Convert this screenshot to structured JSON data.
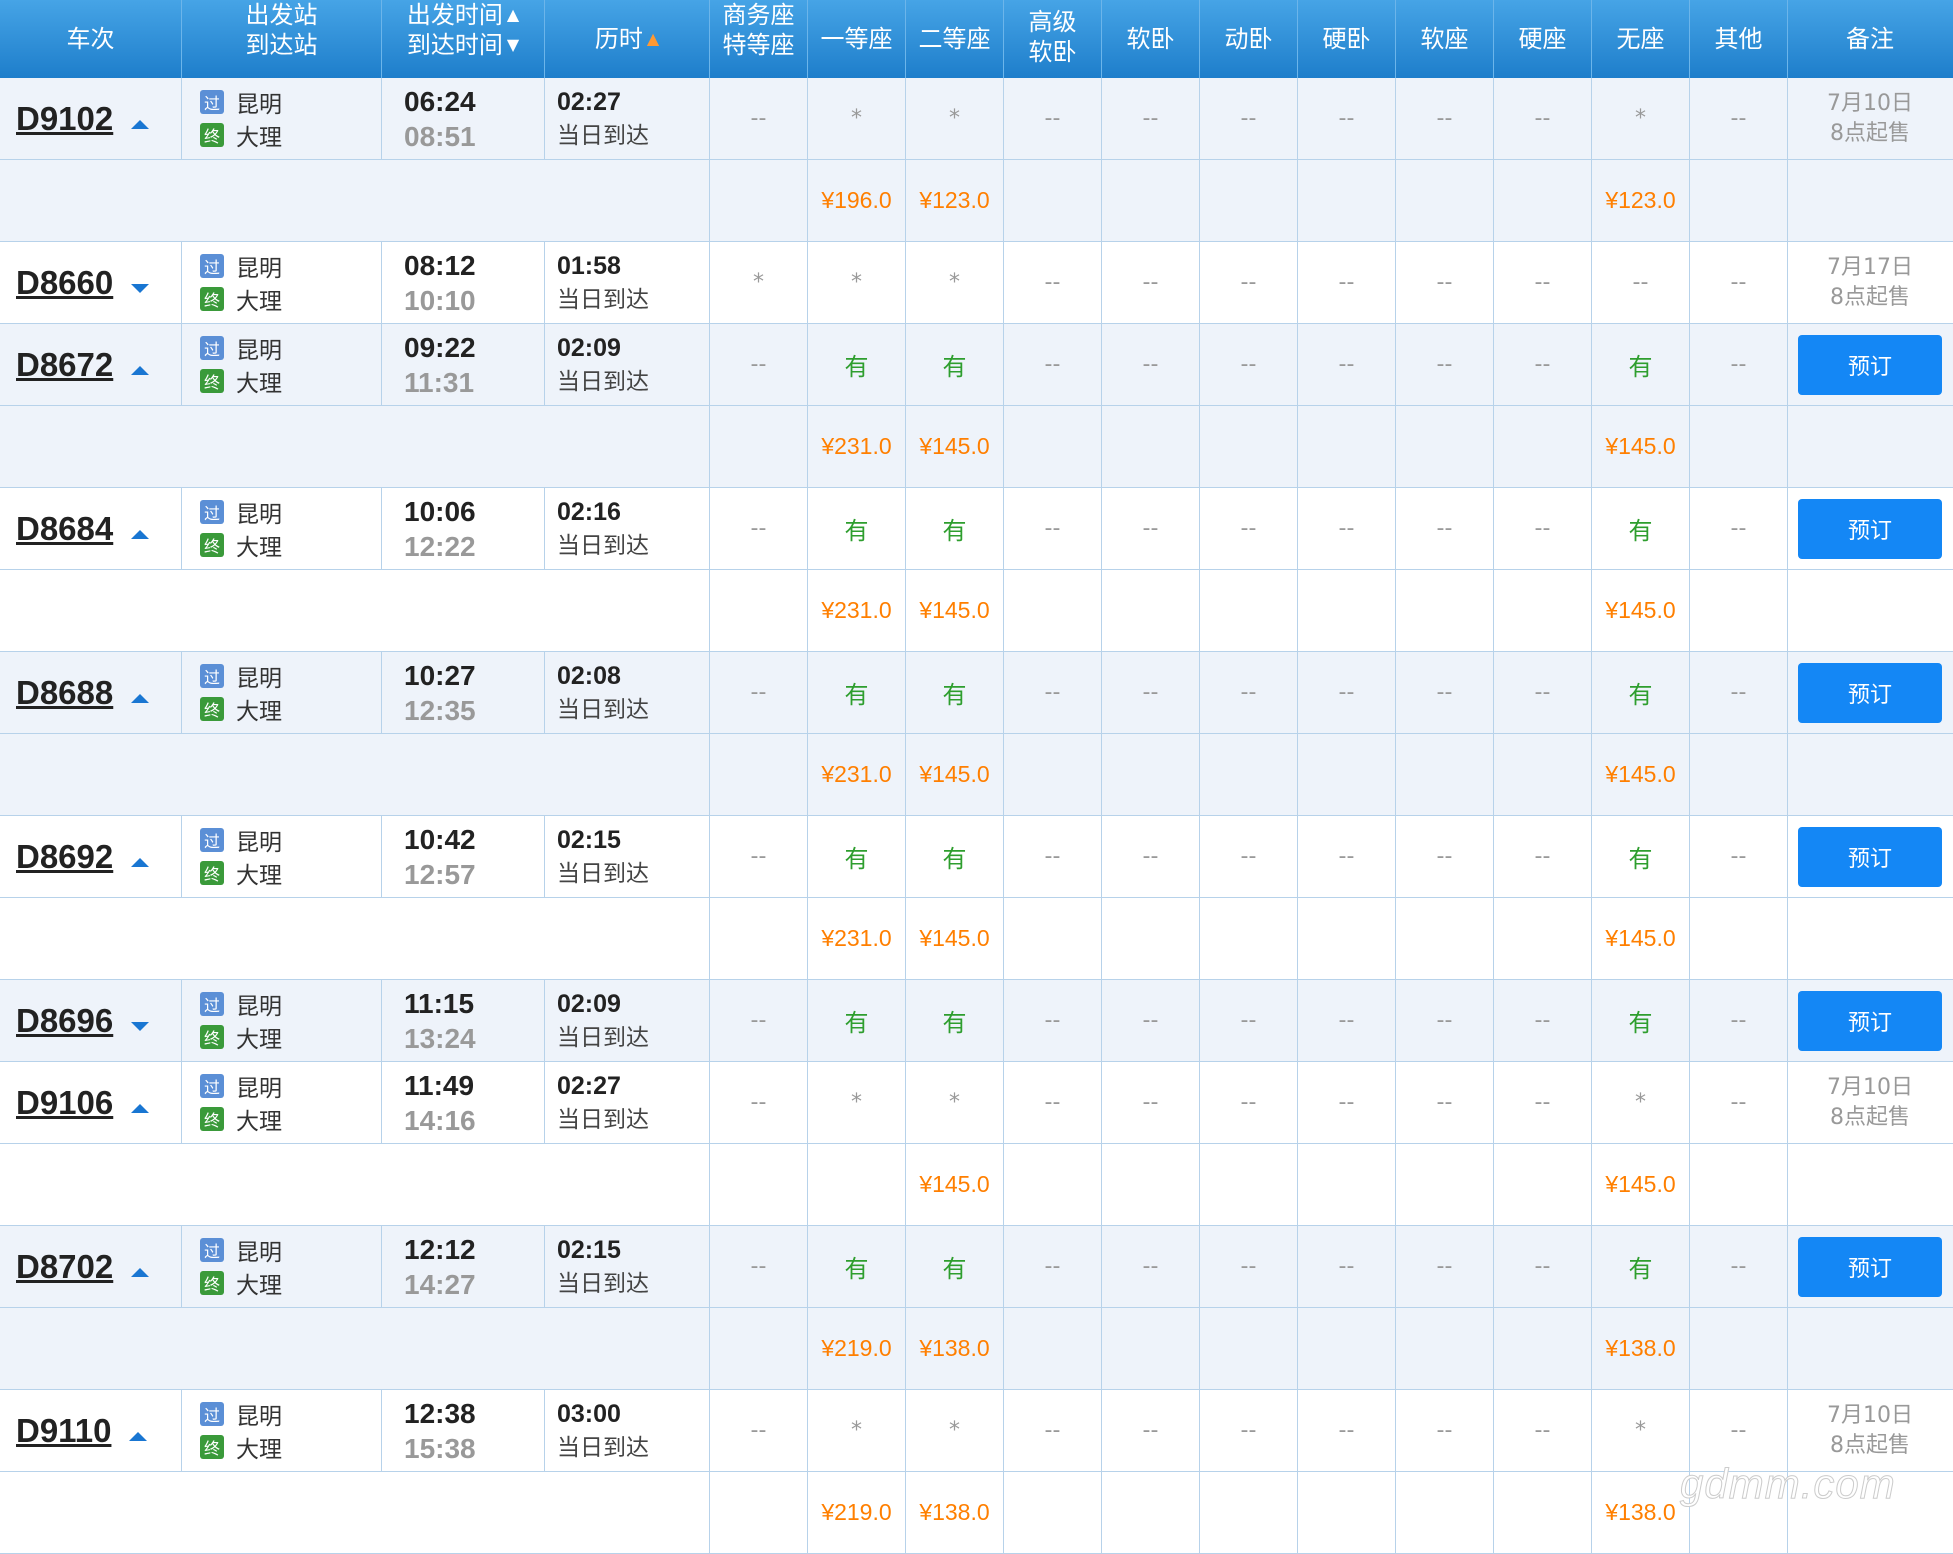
{
  "header": {
    "train": "车次",
    "from": "出发站",
    "to": "到达站",
    "dep_time": "出发时间",
    "arr_time": "到达时间",
    "duration": "历时",
    "business_1": "商务座",
    "business_2": "特等座",
    "first": "一等座",
    "second": "二等座",
    "adv_soft_1": "高级",
    "adv_soft_2": "软卧",
    "soft_sleeper": "软卧",
    "moving_sleeper": "动卧",
    "hard_sleeper": "硬卧",
    "soft_seat": "软座",
    "hard_seat": "硬座",
    "no_seat": "无座",
    "other": "其他",
    "remark": "备注"
  },
  "colors": {
    "header_top": "#46a4e6",
    "header_bottom": "#1e7ecb",
    "row_shade": "#eef3fa",
    "available": "#2e9e2e",
    "price": "#ff7f00",
    "button": "#1487f5"
  },
  "icons": {
    "pass_badge": "过",
    "end_badge": "终"
  },
  "rows": [
    {
      "kind": "train",
      "shade": true,
      "no": "D9102",
      "dir": "up",
      "from": "昆明",
      "to": "大理",
      "dep": "06:24",
      "arr": "08:51",
      "dur": "02:27",
      "note": "当日到达",
      "seats": [
        "--",
        "*",
        "*",
        "--",
        "--",
        "--",
        "--",
        "--",
        "--",
        "*",
        "--"
      ],
      "remark1": "7月10日",
      "remark2": "8点起售",
      "book": ""
    },
    {
      "kind": "price",
      "shade": true,
      "prices": [
        "",
        "¥196.0",
        "¥123.0",
        "",
        "",
        "",
        "",
        "",
        "",
        "¥123.0",
        ""
      ]
    },
    {
      "kind": "train",
      "shade": false,
      "no": "D8660",
      "dir": "down",
      "from": "昆明",
      "to": "大理",
      "dep": "08:12",
      "arr": "10:10",
      "dur": "01:58",
      "note": "当日到达",
      "seats": [
        "*",
        "*",
        "*",
        "--",
        "--",
        "--",
        "--",
        "--",
        "--",
        "--",
        "--"
      ],
      "remark1": "7月17日",
      "remark2": "8点起售",
      "book": ""
    },
    {
      "kind": "train",
      "shade": true,
      "no": "D8672",
      "dir": "up",
      "from": "昆明",
      "to": "大理",
      "dep": "09:22",
      "arr": "11:31",
      "dur": "02:09",
      "note": "当日到达",
      "seats": [
        "--",
        "有",
        "有",
        "--",
        "--",
        "--",
        "--",
        "--",
        "--",
        "有",
        "--"
      ],
      "remark1": "",
      "remark2": "",
      "book": "预订"
    },
    {
      "kind": "price",
      "shade": true,
      "prices": [
        "",
        "¥231.0",
        "¥145.0",
        "",
        "",
        "",
        "",
        "",
        "",
        "¥145.0",
        ""
      ]
    },
    {
      "kind": "train",
      "shade": false,
      "no": "D8684",
      "dir": "up",
      "from": "昆明",
      "to": "大理",
      "dep": "10:06",
      "arr": "12:22",
      "dur": "02:16",
      "note": "当日到达",
      "seats": [
        "--",
        "有",
        "有",
        "--",
        "--",
        "--",
        "--",
        "--",
        "--",
        "有",
        "--"
      ],
      "remark1": "",
      "remark2": "",
      "book": "预订"
    },
    {
      "kind": "price",
      "shade": false,
      "prices": [
        "",
        "¥231.0",
        "¥145.0",
        "",
        "",
        "",
        "",
        "",
        "",
        "¥145.0",
        ""
      ]
    },
    {
      "kind": "train",
      "shade": true,
      "no": "D8688",
      "dir": "up",
      "from": "昆明",
      "to": "大理",
      "dep": "10:27",
      "arr": "12:35",
      "dur": "02:08",
      "note": "当日到达",
      "seats": [
        "--",
        "有",
        "有",
        "--",
        "--",
        "--",
        "--",
        "--",
        "--",
        "有",
        "--"
      ],
      "remark1": "",
      "remark2": "",
      "book": "预订"
    },
    {
      "kind": "price",
      "shade": true,
      "prices": [
        "",
        "¥231.0",
        "¥145.0",
        "",
        "",
        "",
        "",
        "",
        "",
        "¥145.0",
        ""
      ]
    },
    {
      "kind": "train",
      "shade": false,
      "no": "D8692",
      "dir": "up",
      "from": "昆明",
      "to": "大理",
      "dep": "10:42",
      "arr": "12:57",
      "dur": "02:15",
      "note": "当日到达",
      "seats": [
        "--",
        "有",
        "有",
        "--",
        "--",
        "--",
        "--",
        "--",
        "--",
        "有",
        "--"
      ],
      "remark1": "",
      "remark2": "",
      "book": "预订"
    },
    {
      "kind": "price",
      "shade": false,
      "prices": [
        "",
        "¥231.0",
        "¥145.0",
        "",
        "",
        "",
        "",
        "",
        "",
        "¥145.0",
        ""
      ]
    },
    {
      "kind": "train",
      "shade": true,
      "no": "D8696",
      "dir": "down",
      "from": "昆明",
      "to": "大理",
      "dep": "11:15",
      "arr": "13:24",
      "dur": "02:09",
      "note": "当日到达",
      "seats": [
        "--",
        "有",
        "有",
        "--",
        "--",
        "--",
        "--",
        "--",
        "--",
        "有",
        "--"
      ],
      "remark1": "",
      "remark2": "",
      "book": "预订"
    },
    {
      "kind": "train",
      "shade": false,
      "no": "D9106",
      "dir": "up",
      "from": "昆明",
      "to": "大理",
      "dep": "11:49",
      "arr": "14:16",
      "dur": "02:27",
      "note": "当日到达",
      "seats": [
        "--",
        "*",
        "*",
        "--",
        "--",
        "--",
        "--",
        "--",
        "--",
        "*",
        "--"
      ],
      "remark1": "7月10日",
      "remark2": "8点起售",
      "book": ""
    },
    {
      "kind": "price",
      "shade": false,
      "prices": [
        "",
        "",
        "¥145.0",
        "",
        "",
        "",
        "",
        "",
        "",
        "¥145.0",
        ""
      ]
    },
    {
      "kind": "train",
      "shade": true,
      "no": "D8702",
      "dir": "up",
      "from": "昆明",
      "to": "大理",
      "dep": "12:12",
      "arr": "14:27",
      "dur": "02:15",
      "note": "当日到达",
      "seats": [
        "--",
        "有",
        "有",
        "--",
        "--",
        "--",
        "--",
        "--",
        "--",
        "有",
        "--"
      ],
      "remark1": "",
      "remark2": "",
      "book": "预订"
    },
    {
      "kind": "price",
      "shade": true,
      "prices": [
        "",
        "¥219.0",
        "¥138.0",
        "",
        "",
        "",
        "",
        "",
        "",
        "¥138.0",
        ""
      ]
    },
    {
      "kind": "train",
      "shade": false,
      "no": "D9110",
      "dir": "up",
      "from": "昆明",
      "to": "大理",
      "dep": "12:38",
      "arr": "15:38",
      "dur": "03:00",
      "note": "当日到达",
      "seats": [
        "--",
        "*",
        "*",
        "--",
        "--",
        "--",
        "--",
        "--",
        "--",
        "*",
        "--"
      ],
      "remark1": "7月10日",
      "remark2": "8点起售",
      "book": ""
    },
    {
      "kind": "price",
      "shade": false,
      "prices": [
        "",
        "¥219.0",
        "¥138.0",
        "",
        "",
        "",
        "",
        "",
        "",
        "¥138.0",
        ""
      ]
    }
  ],
  "watermark": "gdmm.com"
}
